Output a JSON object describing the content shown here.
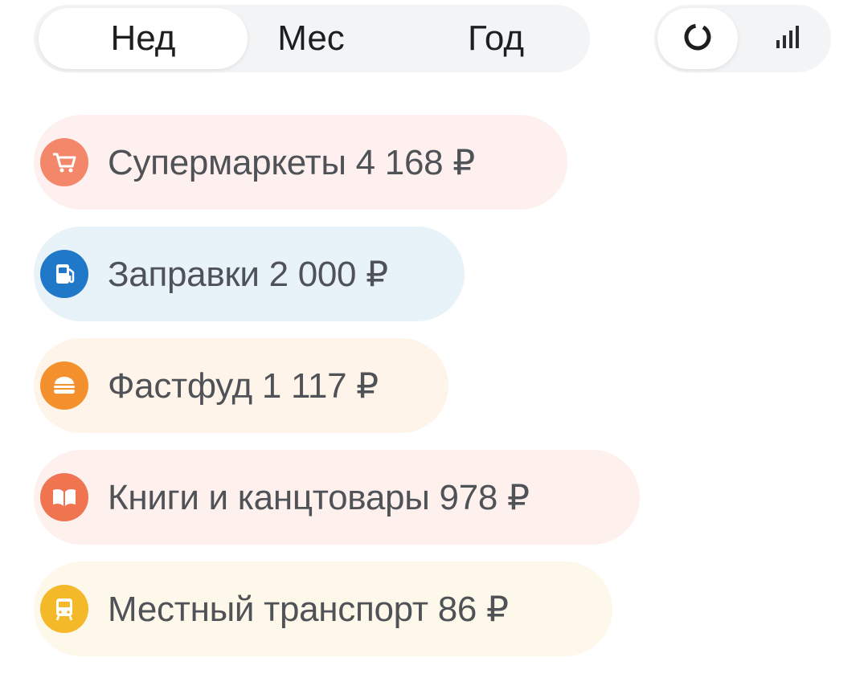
{
  "period_tabs": [
    {
      "label": "Нед",
      "active": true
    },
    {
      "label": "Мес",
      "active": false
    },
    {
      "label": "Год",
      "active": false
    }
  ],
  "view_toggle": {
    "options": [
      {
        "icon": "donut-chart-icon",
        "active": true
      },
      {
        "icon": "bar-chart-icon",
        "active": false
      }
    ]
  },
  "categories": [
    {
      "name": "Супермаркеты",
      "amount": "4 168 ₽",
      "icon": "cart-icon",
      "icon_color": "#f4876a",
      "bg_color": "#fdf0ee"
    },
    {
      "name": "Заправки",
      "amount": "2 000 ₽",
      "icon": "fuel-icon",
      "icon_color": "#1f78c8",
      "bg_color": "#e8f2f9"
    },
    {
      "name": "Фастфуд",
      "amount": "1 117 ₽",
      "icon": "burger-icon",
      "icon_color": "#f4912e",
      "bg_color": "#fef4ea"
    },
    {
      "name": "Книги и канцтовары",
      "amount": "978 ₽",
      "icon": "book-icon",
      "icon_color": "#f0744f",
      "bg_color": "#fdf0ed"
    },
    {
      "name": "Местный транспорт",
      "amount": "86 ₽",
      "icon": "bus-icon",
      "icon_color": "#f4b928",
      "bg_color": "#fef8ea"
    }
  ]
}
